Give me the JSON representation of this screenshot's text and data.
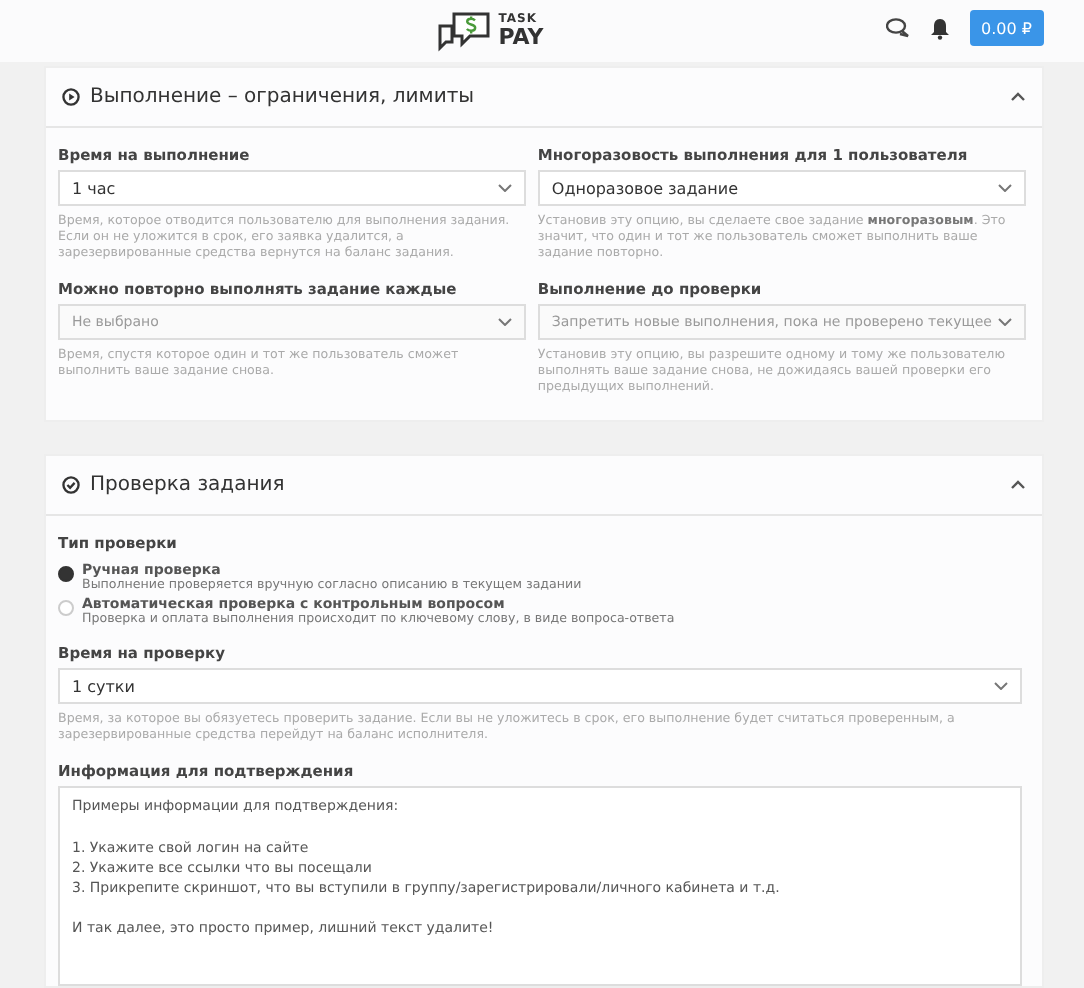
{
  "header": {
    "logo_top": "TASK",
    "logo_bottom": "PAY",
    "balance": "0.00 ₽"
  },
  "sections": [
    {
      "title": "Выполнение – ограничения, лимиты",
      "expanded": true,
      "fields": [
        {
          "label": "Время на выполнение",
          "value": "1 час",
          "hint": "Время, которое отводится пользователю для выполнения задания. Если он не уложится в срок, его заявка удалится, а зарезервированные средства вернутся на баланс задания."
        },
        {
          "label": "Многоразовость выполнения для 1 пользователя",
          "value": "Одноразовое задание",
          "hint": "Установив эту опцию, вы сделаете свое задание **многоразовым**. Это значит, что один и тот же пользователь сможет выполнить ваше задание повторно."
        },
        {
          "label": "Можно повторно выполнять задание каждые",
          "placeholder": "Не выбрано",
          "hint": "Время, спустя которое один и тот же пользователь сможет выполнить ваше задание снова."
        },
        {
          "label": "Выполнение до проверки",
          "placeholder": "Запретить новые выполнения, пока не проверено текущее",
          "hint": "Установив эту опцию, вы разрешите одному и тому же пользователю выполнять ваше задание снова, не дожидаясь вашей проверки его предыдущих выполнений."
        }
      ]
    },
    {
      "title": "Проверка задания",
      "expanded": true,
      "check_type": {
        "label": "Тип проверки",
        "options": [
          {
            "label": "Ручная проверка",
            "description": "Выполнение проверяется вручную согласно описанию в текущем задании",
            "selected": true
          },
          {
            "label": "Автоматическая проверка с контрольным вопросом",
            "description": "Проверка и оплата выполнения происходит по ключевому слову, в виде вопроса-ответа",
            "selected": false
          }
        ]
      },
      "review_time": {
        "label": "Время на проверку",
        "value": "1 сутки",
        "hint": "Время, за которое вы обязуетесь проверить задание. Если вы не уложитесь в срок, его выполнение будет считаться проверенным, а зарезервированные средства перейдут на баланс исполнителя."
      },
      "confirmation": {
        "label": "Информация для подтверждения",
        "value": "Примеры информации для подтверждения:\n\n1. Укажите свой логин на сайте\n2. Укажите все ссылки что вы посещали\n3. Прикрепите скриншот, что вы вступили в группу/зарегистрировали/личного кабинета и т.д.\n\nИ так далее, это просто пример, лишний текст удалите!"
      }
    }
  ]
}
